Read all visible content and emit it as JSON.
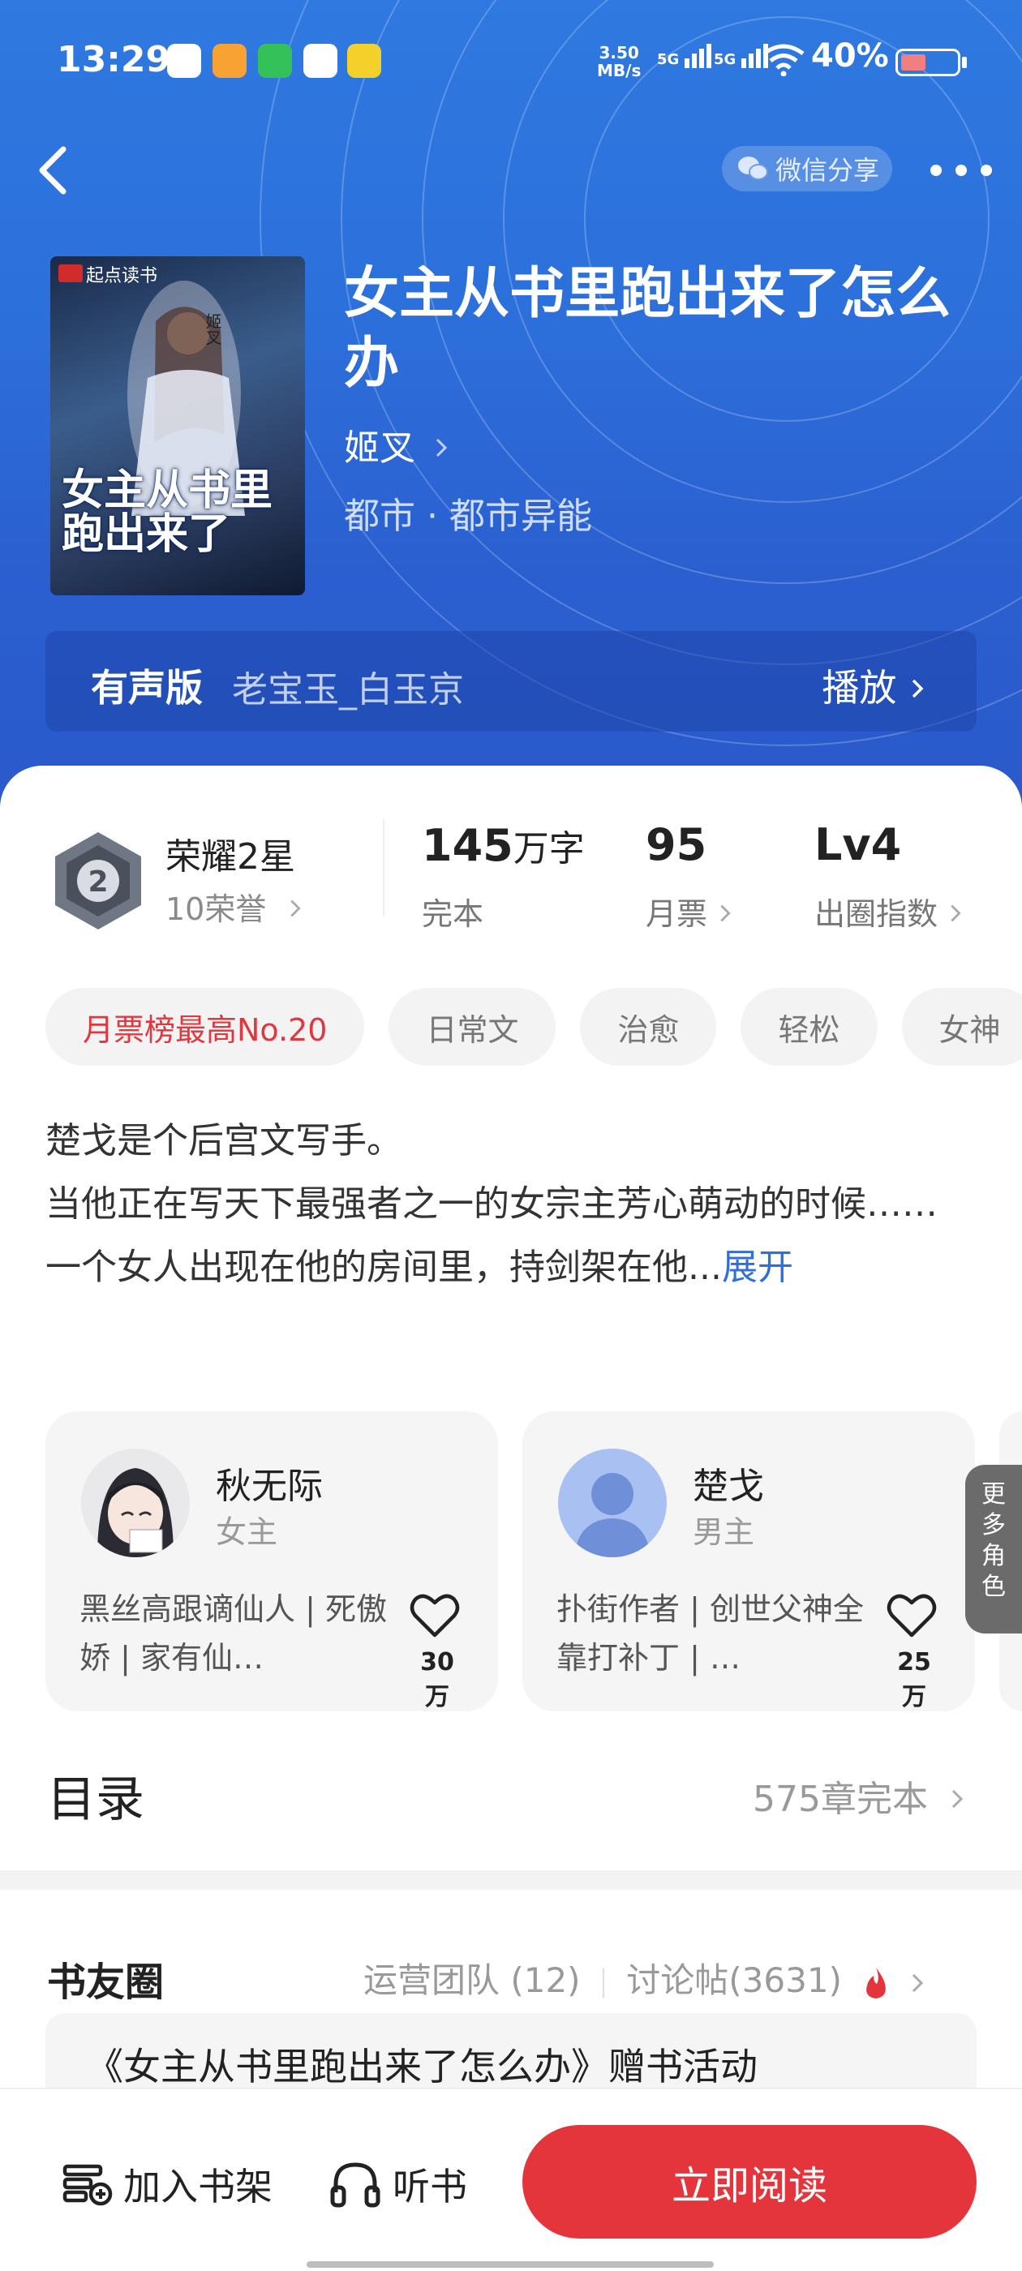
{
  "status_bar": {
    "time": "13:29",
    "net_speed_value": "3.50",
    "net_speed_unit": "MB/s",
    "signal1": "5G",
    "signal2": "5G",
    "battery": "40%"
  },
  "header": {
    "share_label": "微信分享"
  },
  "book": {
    "title": "女主从书里跑出来了怎么办",
    "author": "姬叉",
    "genre": "都市 · 都市异能",
    "cover_brand": "起点读书",
    "cover_title": "女主从书里跑出来了",
    "cover_author": "姬叉"
  },
  "audio": {
    "label": "有声版",
    "narrator": "老宝玉_白玉京",
    "play": "播放"
  },
  "stats": {
    "honor_level": "荣耀2星",
    "honor_points": "10荣誉",
    "badge_num": "2",
    "word_count": "145",
    "word_unit": "万字",
    "status": "完本",
    "monthly_votes": "95",
    "monthly_votes_label": "月票",
    "circle_index": "Lv4",
    "circle_index_label": "出圈指数"
  },
  "tags": [
    "月票榜最高No.20",
    "日常文",
    "治愈",
    "轻松",
    "女神"
  ],
  "description": {
    "line1": "楚戈是个后宫文写手。",
    "line2": "当他正在写天下最强者之一的女宗主芳心萌动的时候……",
    "line3": "一个女人出现在他的房间里，持剑架在他...",
    "expand": "展开"
  },
  "characters": [
    {
      "name": "秋无际",
      "role": "女主",
      "tags": "黑丝高跟谪仙人 | 死傲娇 | 家有仙…",
      "likes": "30万"
    },
    {
      "name": "楚戈",
      "role": "男主",
      "tags": "扑街作者 | 创世父神全靠打补丁 | …",
      "likes": "25万"
    }
  ],
  "more_roles": "更多角色",
  "toc": {
    "title": "目录",
    "summary": "575章完本"
  },
  "circle": {
    "title": "书友圈",
    "team": "运营团队 (12)",
    "posts": "讨论帖(3631)",
    "first_post": "《女主从书里跑出来了怎么办》赠书活动"
  },
  "bottom_bar": {
    "add_shelf": "加入书架",
    "listen": "听书",
    "read_now": "立即阅读"
  },
  "colors": {
    "hero_blue": "#2c6fdb",
    "accent_red": "#e5353c",
    "link_blue": "#2f6fda"
  }
}
